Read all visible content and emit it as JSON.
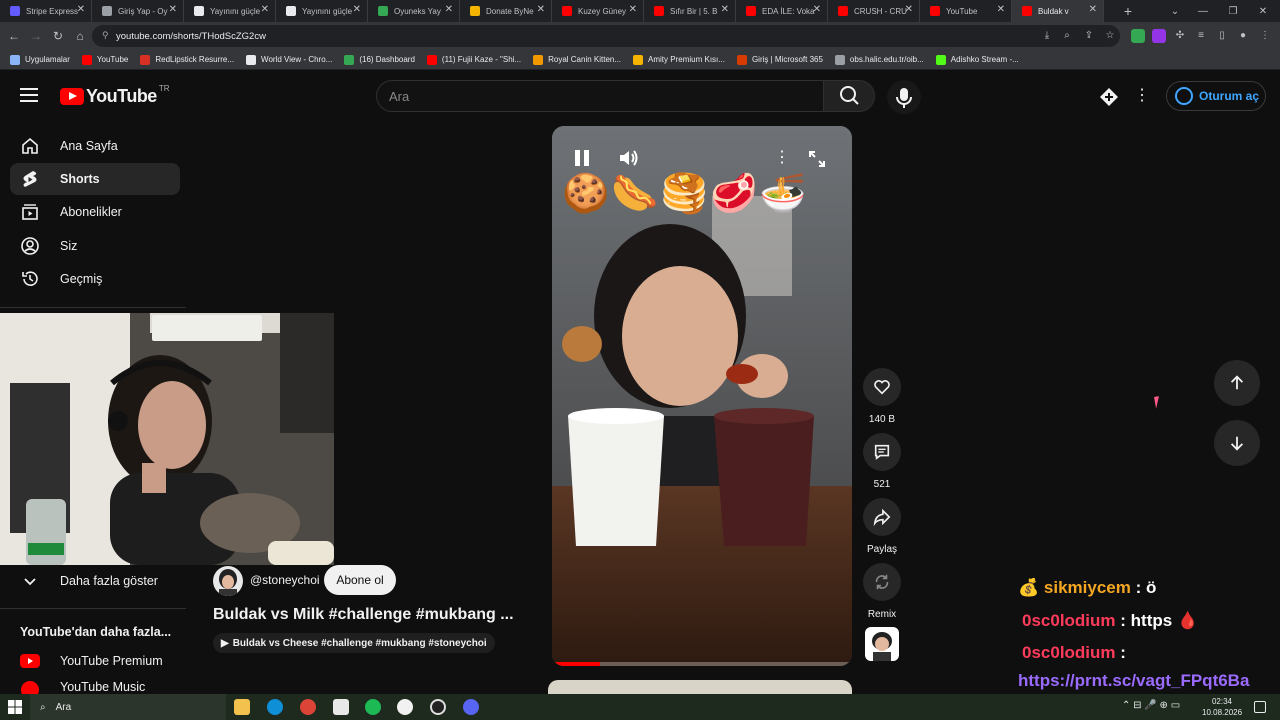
{
  "browser": {
    "tabs": [
      {
        "label": "Stripe Express",
        "color": "#635bff"
      },
      {
        "label": "Giriş Yap - Oy",
        "color": "#9aa0a6"
      },
      {
        "label": "Yayınını güçle",
        "color": "#e8eaed"
      },
      {
        "label": "Yayınını güçle",
        "color": "#e8eaed"
      },
      {
        "label": "Oyuneks Yay",
        "color": "#34a853"
      },
      {
        "label": "Donate ByNe",
        "color": "#f4b400"
      },
      {
        "label": "Kuzey Güney",
        "color": "#ff0000"
      },
      {
        "label": "Sıfır Bir | 5. B",
        "color": "#ff0000"
      },
      {
        "label": "EDA İLE: Voka",
        "color": "#ff0000"
      },
      {
        "label": "CRUSH - CRU",
        "color": "#ff0000"
      },
      {
        "label": "YouTube",
        "color": "#ff0000"
      },
      {
        "label": "Buldak v",
        "color": "#ff0000"
      }
    ],
    "url": "youtube.com/shorts/THodScZG2cw",
    "bookmarks": [
      {
        "label": "Uygulamalar",
        "color": "#8ab4f8"
      },
      {
        "label": "YouTube",
        "color": "#ff0000"
      },
      {
        "label": "RedLipstick Resurre...",
        "color": "#d93025"
      },
      {
        "label": "World View - Chro...",
        "color": "#e8eaed"
      },
      {
        "label": "(16) Dashboard",
        "color": "#34a853"
      },
      {
        "label": "(11) Fujii Kaze - \"Shi...",
        "color": "#ff0000"
      },
      {
        "label": "Royal Canin Kitten...",
        "color": "#f29900"
      },
      {
        "label": "Amity Premium Kısı...",
        "color": "#f4b400"
      },
      {
        "label": "Giriş | Microsoft 365",
        "color": "#d83b01"
      },
      {
        "label": "obs.halic.edu.tr/oib...",
        "color": "#9aa0a6"
      },
      {
        "label": "Adishko Stream -...",
        "color": "#53fc18"
      }
    ]
  },
  "header": {
    "logo_text": "YouTube",
    "region": "TR",
    "search_placeholder": "Ara",
    "signin_label": "Oturum aç"
  },
  "sidebar": {
    "items": [
      {
        "label": "Ana Sayfa",
        "icon": "home-icon"
      },
      {
        "label": "Shorts",
        "icon": "shorts-icon",
        "active": true
      },
      {
        "label": "Abonelikler",
        "icon": "subscriptions-icon"
      },
      {
        "label": "Siz",
        "icon": "you-icon"
      },
      {
        "label": "Geçmiş",
        "icon": "history-icon"
      }
    ],
    "show_more": "Daha fazla göster",
    "more_from_heading": "YouTube'dan daha fazla...",
    "more_items": [
      "YouTube Premium",
      "YouTube Music"
    ]
  },
  "short": {
    "channel": "@stoneychoi",
    "subscribe_label": "Abone ol",
    "title": "Buldak vs Milk #challenge #mukbang ...",
    "related": "Buldak vs Cheese #challenge #mukbang #stoneychoi",
    "likes": "140 B",
    "comments": "521",
    "share_label": "Paylaş",
    "remix_label": "Remix",
    "progress": 0.16
  },
  "chat": [
    {
      "user": "sikmiycem",
      "user_color": "#f4a623",
      "text": "ö",
      "emoji": "💰"
    },
    {
      "user": "0sc0lodium",
      "user_color": "#ff3b5c",
      "text": "https",
      "emoji": "🩸"
    },
    {
      "user": "0sc0lodium",
      "user_color": "#ff3b5c",
      "text": ""
    },
    {
      "link": "https://prnt.sc/vagt_FPqt6Ba",
      "link_color": "#9b6bff"
    }
  ],
  "taskbar": {
    "search_label": "Ara",
    "time": "02:34",
    "date": "10.08.2026"
  }
}
